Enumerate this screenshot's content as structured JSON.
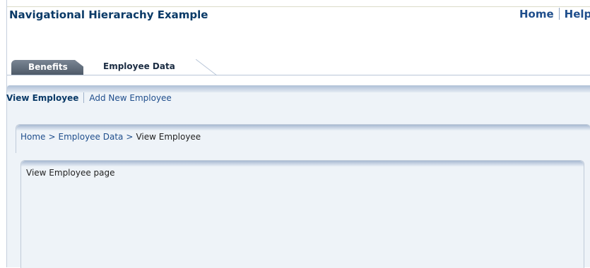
{
  "header": {
    "title": "Navigational Hierarachy Example",
    "global_links": [
      "Home",
      "Help"
    ]
  },
  "tabs": [
    {
      "label": "Benefits",
      "selected": false
    },
    {
      "label": "Employee Data",
      "selected": true
    }
  ],
  "subtabs": {
    "active": "View Employee",
    "other": "Add New Employee"
  },
  "breadcrumb": {
    "items": [
      "Home",
      "Employee Data"
    ],
    "separator": ">",
    "current": "View Employee"
  },
  "content": {
    "text": "View Employee page"
  },
  "colors": {
    "title": "#0a3a67",
    "link": "#1f4e8c",
    "band_background": "#eef3f8",
    "inactive_tab": "#5a6674"
  }
}
